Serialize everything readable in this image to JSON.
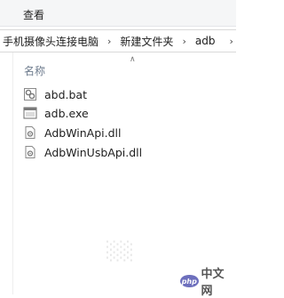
{
  "menu": {
    "view": "查看"
  },
  "breadcrumb": {
    "items": [
      "手机摄像头连接电脑",
      "新建文件夹",
      "adb"
    ]
  },
  "columns": {
    "name": "名称"
  },
  "files": [
    {
      "name": "abd.bat",
      "icon": "batch-file-icon"
    },
    {
      "name": "adb.exe",
      "icon": "exe-file-icon"
    },
    {
      "name": "AdbWinApi.dll",
      "icon": "dll-file-icon"
    },
    {
      "name": "AdbWinUsbApi.dll",
      "icon": "dll-file-icon"
    }
  ],
  "watermark": {
    "php_badge": "php",
    "site": "中文网"
  }
}
